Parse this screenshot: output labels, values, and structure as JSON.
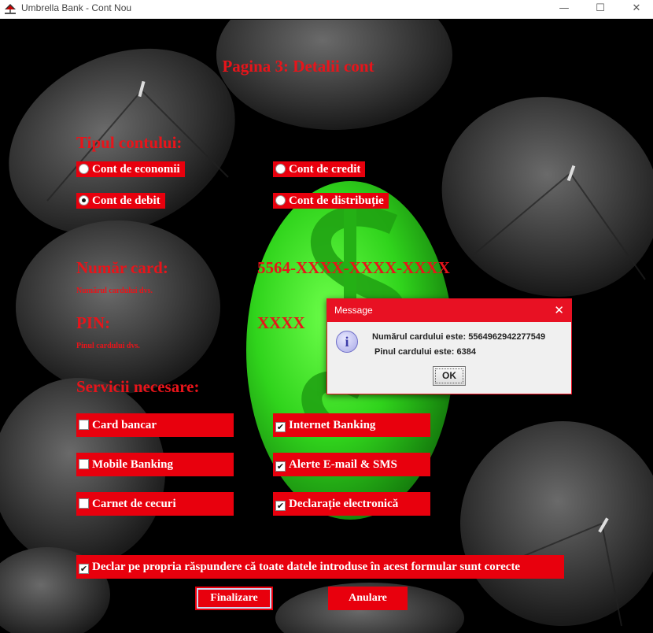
{
  "window": {
    "title": "Umbrella Bank - Cont Nou",
    "minimize": "—",
    "maximize": "☐",
    "close": "✕"
  },
  "page": {
    "title": "Pagina 3: Detalii cont"
  },
  "account_type": {
    "heading": "Tipul contului:",
    "options": [
      {
        "label": "Cont de economii",
        "selected": false
      },
      {
        "label": "Cont de credit",
        "selected": false
      },
      {
        "label": "Cont de debit",
        "selected": true
      },
      {
        "label": "Cont de distribuție",
        "selected": false
      }
    ]
  },
  "card": {
    "label": "Număr card:",
    "value": "5564-XXXX-XXXX-XXXX",
    "hint": "Numărul cardului dvs."
  },
  "pin": {
    "label": "PIN:",
    "value": "XXXX",
    "hint": "Pinul cardului dvs."
  },
  "services": {
    "heading": "Servicii necesare:",
    "options": [
      {
        "label": "Card bancar",
        "checked": false
      },
      {
        "label": "Internet Banking",
        "checked": true
      },
      {
        "label": "Mobile Banking",
        "checked": false
      },
      {
        "label": "Alerte E-mail & SMS",
        "checked": true
      },
      {
        "label": "Carnet de cecuri",
        "checked": false
      },
      {
        "label": "Declarație electronică",
        "checked": true
      }
    ]
  },
  "declaration": {
    "label": "Declar pe propria răspundere că toate datele introduse în acest formular sunt corecte",
    "checked": true
  },
  "buttons": {
    "finalize": "Finalizare",
    "cancel": "Anulare"
  },
  "dialog": {
    "title": "Message",
    "line1": "Numărul cardului este: 5564962942277549",
    "line2": "Pinul cardului este: 6384",
    "ok": "OK",
    "close": "✕",
    "icon": "i"
  },
  "colors": {
    "accent_red": "#e8000d",
    "text_red": "#e8141a",
    "dialog_header": "#e81123",
    "dollar_green": "#2ecc1a"
  }
}
